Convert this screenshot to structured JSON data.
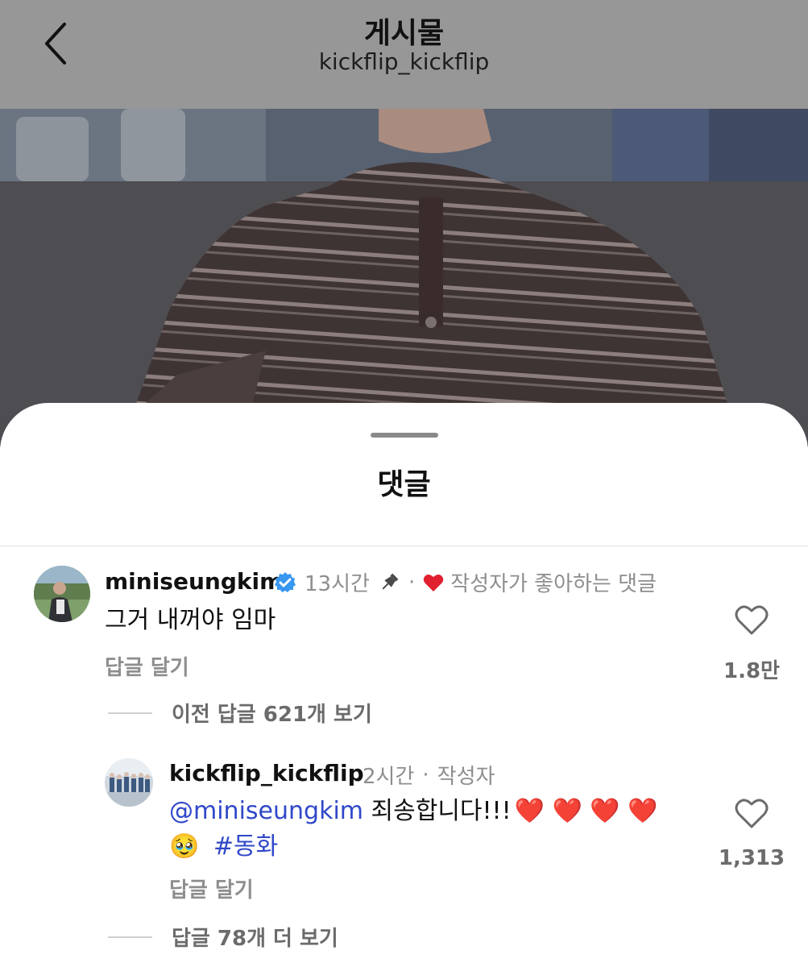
{
  "header": {
    "title": "게시물",
    "subtitle": "kickflip_kickflip"
  },
  "sheet": {
    "title": "댓글"
  },
  "comments": [
    {
      "username": "miniseungkim",
      "verified": true,
      "time": "13시간",
      "pinned": true,
      "liked_by_author_label": "작성자가 좋아하는 댓글",
      "text": "그거 내꺼야 임마",
      "reply_label": "답글 달기",
      "like_count": "1.8만",
      "view_replies_label": "이전 답글 621개 보기"
    }
  ],
  "reply": {
    "username": "kickflip_kickflip",
    "time": "2시간",
    "author_badge": "작성자",
    "mention": "@miniseungkim",
    "text_main": " 죄송합니다!!!",
    "emoji_hearts": "❤️ ❤️ ❤️ ❤️",
    "emoji_face": "🥹",
    "hashtag": "#동화",
    "reply_label": "답글 달기",
    "like_count": "1,313",
    "more_replies_label": "답글 78개 더 보기"
  },
  "colors": {
    "mention": "#3048c9",
    "verified": "#3897f0",
    "heart": "#e0202f"
  },
  "icons": [
    "back-chevron-icon",
    "verified-badge-icon",
    "pin-icon",
    "heart-icon"
  ]
}
